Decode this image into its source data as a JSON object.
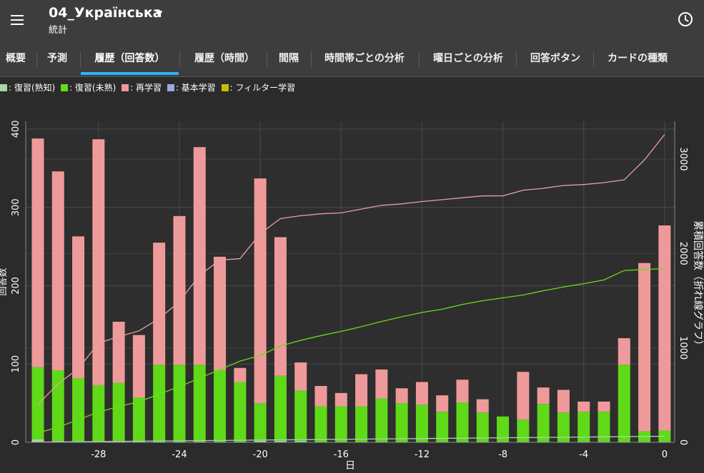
{
  "app_bar": {
    "title": "04_Українська",
    "subtitle": "統計"
  },
  "tabs": [
    {
      "label": "概要"
    },
    {
      "label": "予測"
    },
    {
      "label": "履歴（回答数）",
      "active": true
    },
    {
      "label": "履歴（時間）"
    },
    {
      "label": "間隔"
    },
    {
      "label": "時間帯ごとの分析"
    },
    {
      "label": "曜日ごとの分析"
    },
    {
      "label": "回答ボタン"
    },
    {
      "label": "カードの種類"
    }
  ],
  "legend": [
    {
      "label": ": 復習(熟知)",
      "color": "#a5d6a7"
    },
    {
      "label": ": 復習(未熟)",
      "color": "#64dd17"
    },
    {
      "label": ": 再学習",
      "color": "#ef9a9a"
    },
    {
      "label": ": 基本学習",
      "color": "#9fa8da"
    },
    {
      "label": ": フィルター学習",
      "color": "#c6c000"
    }
  ],
  "colors": {
    "mature": "#a5d6a7",
    "young": "#5fd918",
    "relearn": "#ef9a9a",
    "learn": "#9fa8da",
    "filtered": "#c6c000",
    "cumulative_total": "#e8a0a0",
    "cumulative_young": "#64dd17",
    "cumulative_mature": "#a5d6a7",
    "tab_indicator": "#29b6f6"
  },
  "chart_data": {
    "type": "bar",
    "stacked": true,
    "xlabel": "日",
    "ylabel": "回答数",
    "y2label": "累積回答数（折れ線グラフ）",
    "x": [
      -31,
      -30,
      -29,
      -28,
      -27,
      -26,
      -25,
      -24,
      -23,
      -22,
      -21,
      -20,
      -19,
      -18,
      -17,
      -16,
      -15,
      -14,
      -13,
      -12,
      -11,
      -10,
      -9,
      -8,
      -7,
      -6,
      -5,
      -4,
      -3,
      -2,
      -1,
      0
    ],
    "xlim": [
      -31.6,
      0.5
    ],
    "xticks": [
      -28,
      -24,
      -20,
      -16,
      -12,
      -8,
      -4,
      0
    ],
    "ylim": [
      0,
      410
    ],
    "yticks": [
      0,
      100,
      200,
      300,
      400
    ],
    "y2lim": [
      0,
      3400
    ],
    "y2ticks": [
      0,
      1000,
      2000,
      3000
    ],
    "series": [
      {
        "name": "復習(熟知)",
        "key": "mature",
        "values": [
          4,
          2,
          1,
          1,
          2,
          1,
          1,
          1,
          1,
          1,
          1,
          2,
          2,
          2,
          1,
          1,
          1,
          1,
          1,
          1,
          1,
          1,
          1,
          1,
          1,
          1,
          1,
          1,
          1,
          1,
          1,
          1
        ]
      },
      {
        "name": "復習(未熟)",
        "key": "young",
        "values": [
          92,
          90,
          81,
          72,
          74,
          56,
          98,
          98,
          98,
          91,
          76,
          48,
          83,
          64,
          45,
          45,
          45,
          55,
          49,
          47,
          38,
          50,
          37,
          32,
          28,
          48,
          37,
          38,
          38,
          98,
          13,
          14
        ]
      },
      {
        "name": "再学習",
        "key": "relearn",
        "values": [
          292,
          254,
          181,
          314,
          78,
          80,
          156,
          190,
          278,
          145,
          18,
          287,
          177,
          36,
          26,
          17,
          41,
          37,
          19,
          29,
          21,
          29,
          17,
          0,
          61,
          21,
          29,
          13,
          13,
          34,
          215,
          262
        ]
      }
    ],
    "cumulative": [
      {
        "name": "累積",
        "key": "cumulative_total",
        "values": [
          400,
          620,
          780,
          1050,
          1120,
          1180,
          1310,
          1490,
          1770,
          1930,
          1945,
          2210,
          2370,
          2400,
          2420,
          2430,
          2470,
          2510,
          2525,
          2550,
          2570,
          2590,
          2610,
          2610,
          2670,
          2690,
          2720,
          2730,
          2750,
          2780,
          2990,
          3260
        ]
      },
      {
        "name": "累積(未熟)",
        "key": "cumulative_young",
        "values": [
          100,
          160,
          240,
          320,
          380,
          430,
          510,
          590,
          680,
          770,
          860,
          920,
          1020,
          1080,
          1130,
          1175,
          1225,
          1280,
          1330,
          1375,
          1410,
          1460,
          1500,
          1530,
          1560,
          1605,
          1645,
          1680,
          1720,
          1820,
          1830,
          1840
        ]
      },
      {
        "name": "累積(熟知)",
        "key": "cumulative_mature",
        "values": [
          3,
          5,
          7,
          8,
          10,
          12,
          14,
          16,
          18,
          20,
          22,
          24,
          26,
          28,
          30,
          32,
          34,
          36,
          38,
          40,
          42,
          44,
          46,
          48,
          50,
          52,
          54,
          56,
          58,
          60,
          62,
          64
        ]
      }
    ]
  }
}
